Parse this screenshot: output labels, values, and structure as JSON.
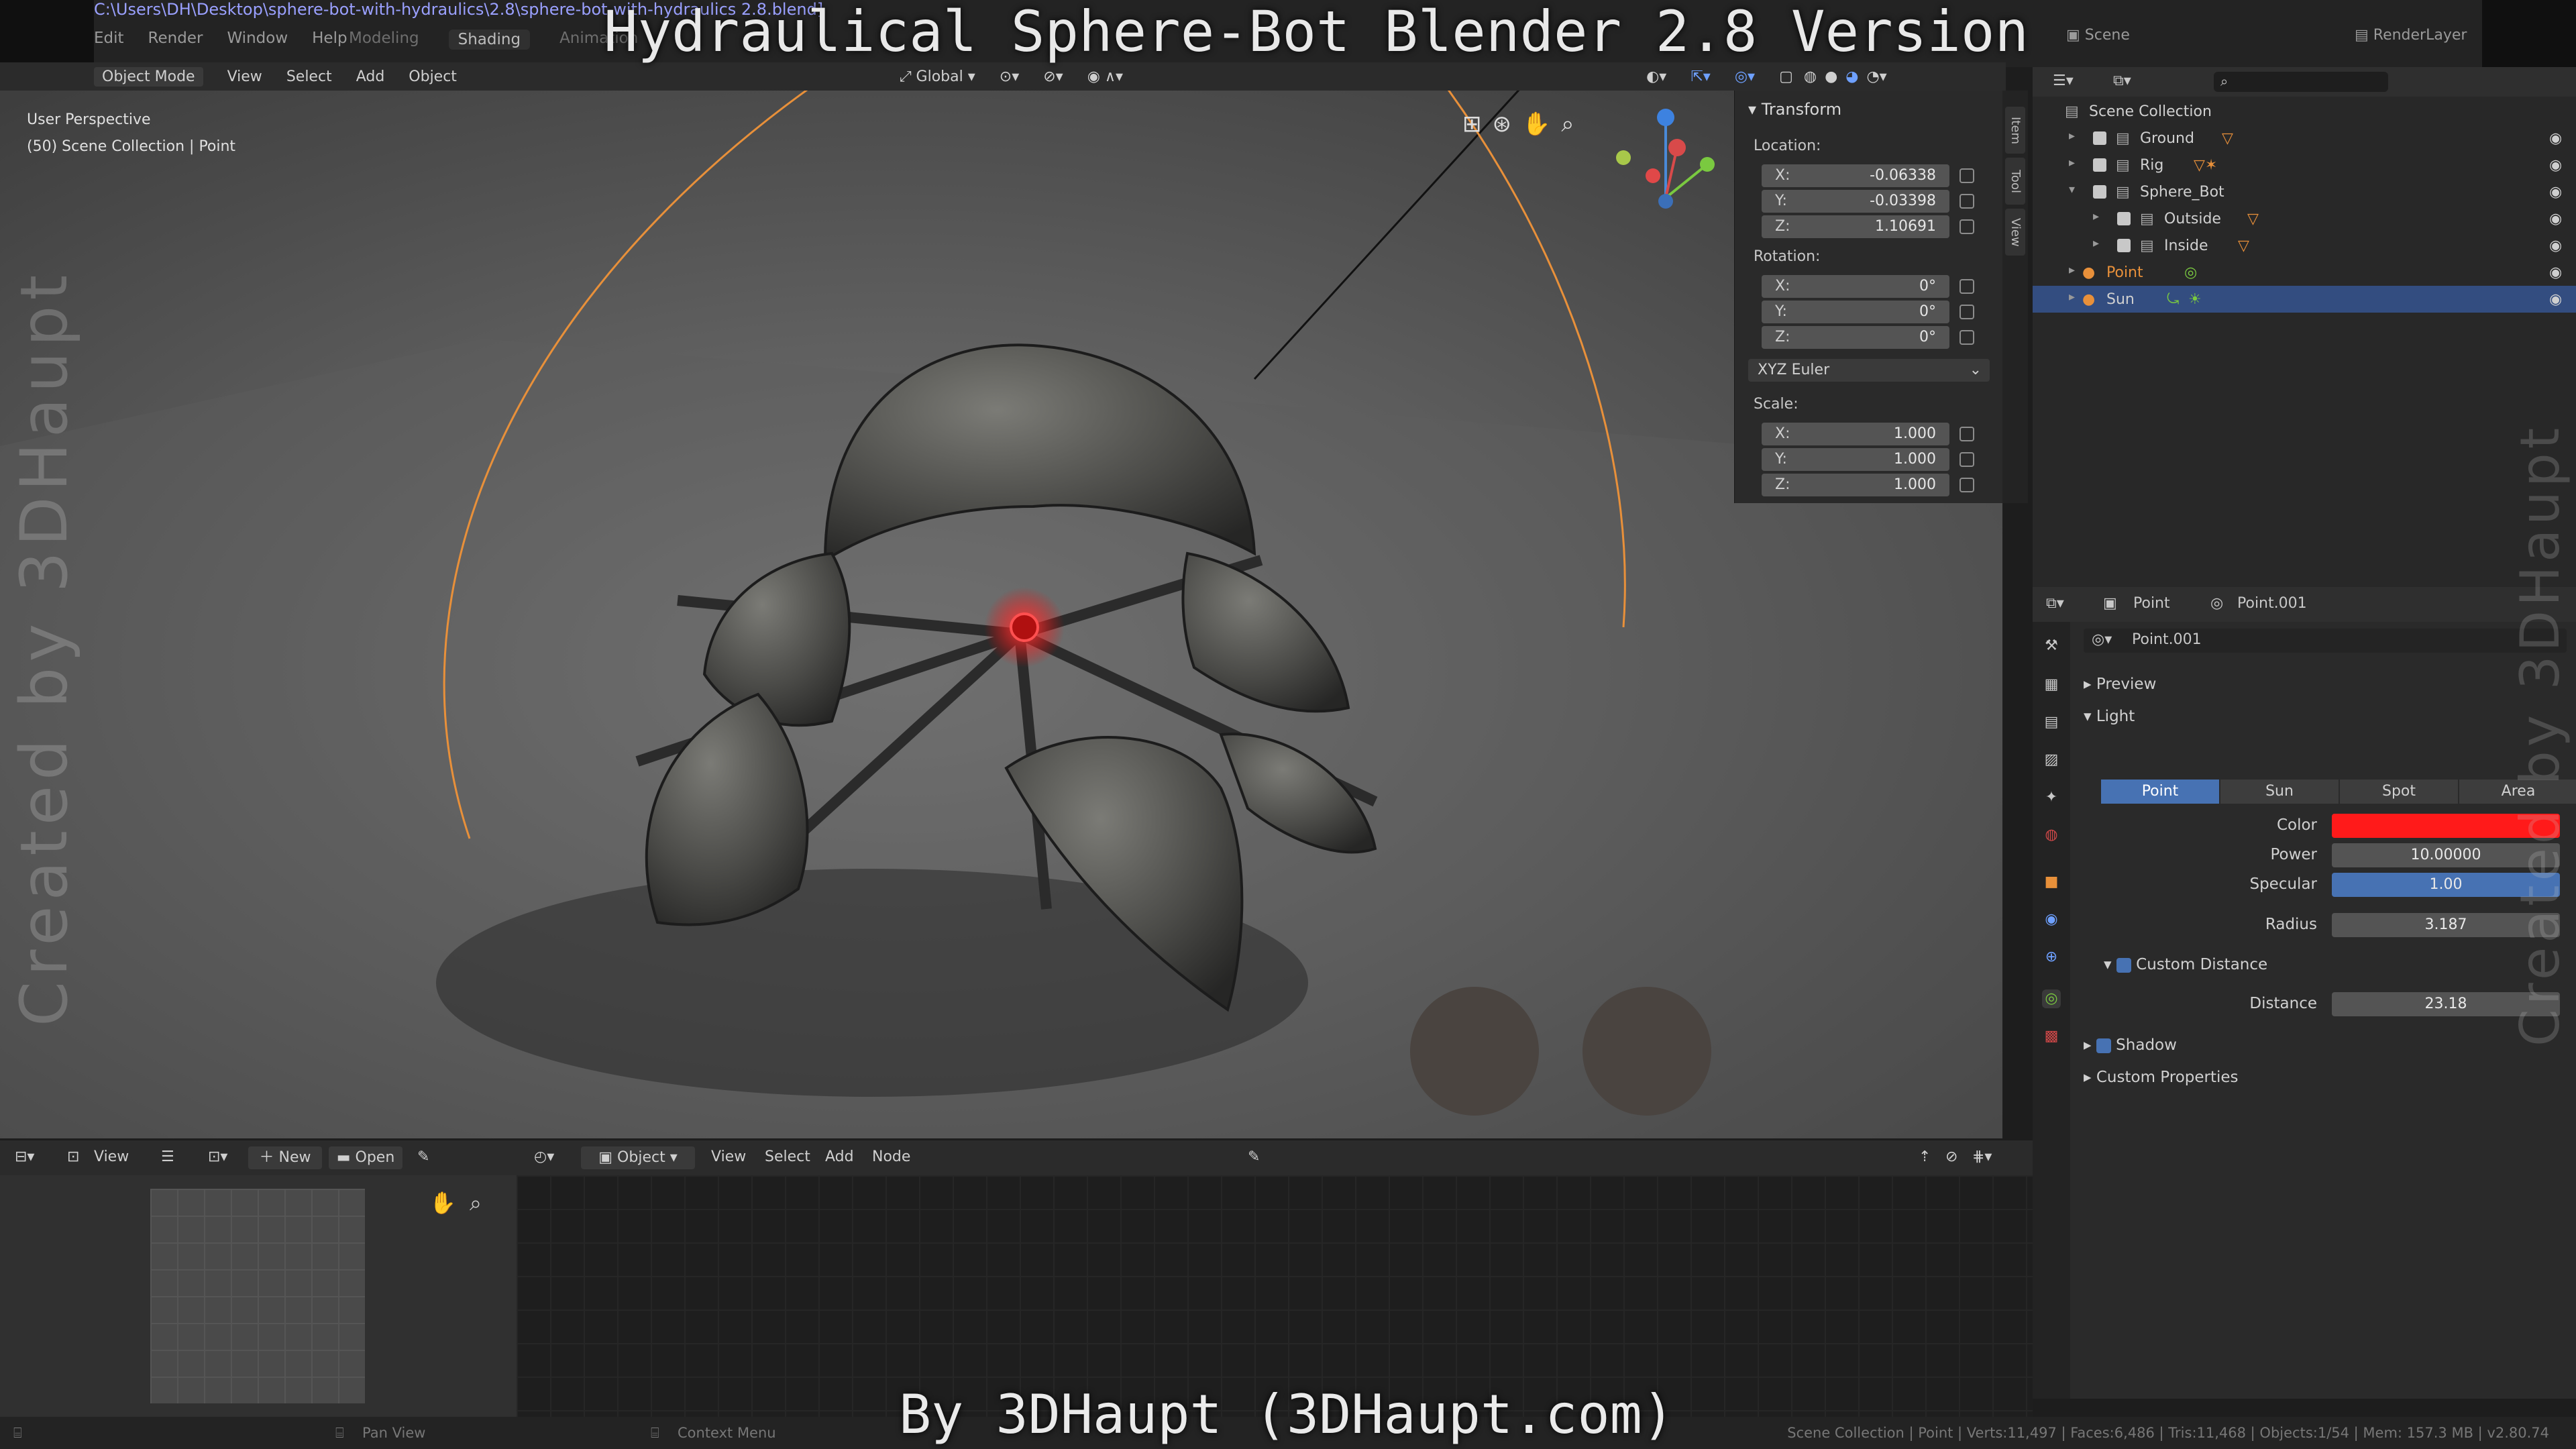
{
  "window": {
    "title_path": "C:\\Users\\DH\\Desktop\\sphere-bot-with-hydraulics\\2.8\\sphere-bot-with-hydraulics 2.8.blend]",
    "menu": [
      "Edit",
      "Render",
      "Window",
      "Help"
    ],
    "workspaces": [
      "Modeling",
      "Shading",
      "Animation"
    ],
    "active_workspace": "Shading",
    "scene": "Scene",
    "render_layer": "RenderLayer"
  },
  "overlay": {
    "title": "Hydraulical Sphere-Bot Blender 2.8 Version",
    "footer": "By 3DHaupt (3DHaupt.com)",
    "watermark": "Created by 3DHaupt"
  },
  "viewport_header": {
    "mode": "Object Mode",
    "menus": [
      "View",
      "Select",
      "Add",
      "Object"
    ],
    "orientation": "Global"
  },
  "viewport": {
    "perspective": "User Perspective",
    "collection": "(50) Scene Collection | Point"
  },
  "npanel": {
    "title": "Transform",
    "location_label": "Location:",
    "location": {
      "x": "-0.06338",
      "y": "-0.03398",
      "z": "1.10691"
    },
    "rotation_label": "Rotation:",
    "rotation": {
      "x": "0°",
      "y": "0°",
      "z": "0°"
    },
    "rotation_mode": "XYZ Euler",
    "scale_label": "Scale:",
    "scale": {
      "x": "1.000",
      "y": "1.000",
      "z": "1.000"
    },
    "axis": {
      "x": "X:",
      "y": "Y:",
      "z": "Z:"
    },
    "tabs": [
      "Item",
      "Tool",
      "View"
    ]
  },
  "outliner": {
    "root": "Scene Collection",
    "items": [
      {
        "label": "Ground"
      },
      {
        "label": "Rig"
      },
      {
        "label": "Sphere_Bot"
      },
      {
        "label": "Outside"
      },
      {
        "label": "Inside"
      },
      {
        "label": "Point"
      },
      {
        "label": "Sun"
      }
    ]
  },
  "properties": {
    "object": "Point",
    "data": "Point.001",
    "datablock": "Point.001",
    "sections": {
      "preview": "Preview",
      "light": "Light",
      "shadow": "Shadow",
      "custom_properties": "Custom Properties"
    },
    "light_types": [
      "Point",
      "Sun",
      "Spot",
      "Area"
    ],
    "active_light_type": "Point",
    "color_label": "Color",
    "color_value": "#ff1a1a",
    "power_label": "Power",
    "power": "10.00000",
    "specular_label": "Specular",
    "specular": "1.00",
    "radius_label": "Radius",
    "radius": "3.187",
    "custom_distance_label": "Custom Distance",
    "distance_label": "Distance",
    "distance": "23.18"
  },
  "image_editor_header": {
    "view": "View",
    "new": "New",
    "open": "Open"
  },
  "node_editor_header": {
    "type": "Object",
    "menus": [
      "View",
      "Select",
      "Add",
      "Node"
    ]
  },
  "statusbar": {
    "pan": "Pan View",
    "context": "Context Menu",
    "stats": "Scene Collection | Point | Verts:11,497 | Faces:6,486 | Tris:11,468 | Objects:1/54 | Mem: 157.3 MB | v2.80.74"
  },
  "colors": {
    "accent": "#4772b3",
    "selected_row": "#334d80",
    "light_color": "#ff1a1a",
    "orange_sel": "#e8903a"
  }
}
